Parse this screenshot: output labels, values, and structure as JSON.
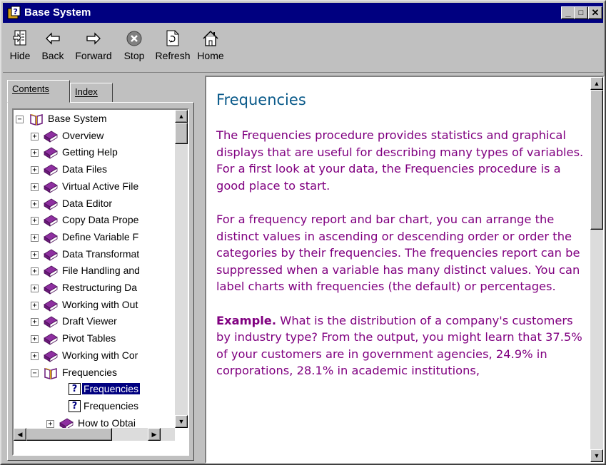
{
  "window": {
    "title": "Base System",
    "title_bg": "#000080",
    "buttons": [
      "_",
      "□",
      "✕"
    ]
  },
  "toolbar": [
    {
      "label": "Hide",
      "icon": "hide-icon"
    },
    {
      "label": "Back",
      "icon": "back-arrow-icon"
    },
    {
      "label": "Forward",
      "icon": "forward-arrow-icon"
    },
    {
      "label": "Stop",
      "icon": "stop-icon"
    },
    {
      "label": "Refresh",
      "icon": "refresh-icon"
    },
    {
      "label": "Home",
      "icon": "home-icon"
    }
  ],
  "tabs": {
    "contents": "Contents",
    "index": "Index"
  },
  "tree": {
    "root": "Base System",
    "items": [
      "Overview",
      "Getting Help",
      "Data Files",
      "Virtual Active File",
      "Data Editor",
      "Copy Data Prope",
      "Define Variable F",
      "Data Transformat",
      "File Handling and",
      "Restructuring Da",
      "Working with Out",
      "Draft Viewer",
      "Pivot Tables",
      "Working with Cor",
      "Frequencies"
    ],
    "children": [
      "Frequencies",
      "Frequencies",
      "How to Obtai"
    ],
    "selected_child": "Frequencies"
  },
  "content": {
    "title": "Frequencies",
    "p1": "The Frequencies procedure provides statistics and graphical displays that are useful for describing many types of variables. For a first look at your data, the Frequencies procedure is a good place to start.",
    "p2": "For a frequency report and bar chart, you can arrange the distinct values in ascending or descending order or order the categories by their frequencies. The frequencies report can be suppressed when a variable has many distinct values. You can label charts with frequencies (the default) or percentages.",
    "p3_bold": "Example.",
    "p3": " What is the distribution of a company's customers by industry type? From the output, you might learn that 37.5% of your customers are in government agencies, 24.9% in corporations, 28.1% in academic institutions,"
  },
  "colors": {
    "book": "#6b1a7a",
    "content_text": "#800080",
    "heading": "#0a5a8a",
    "selection": "#000080"
  }
}
